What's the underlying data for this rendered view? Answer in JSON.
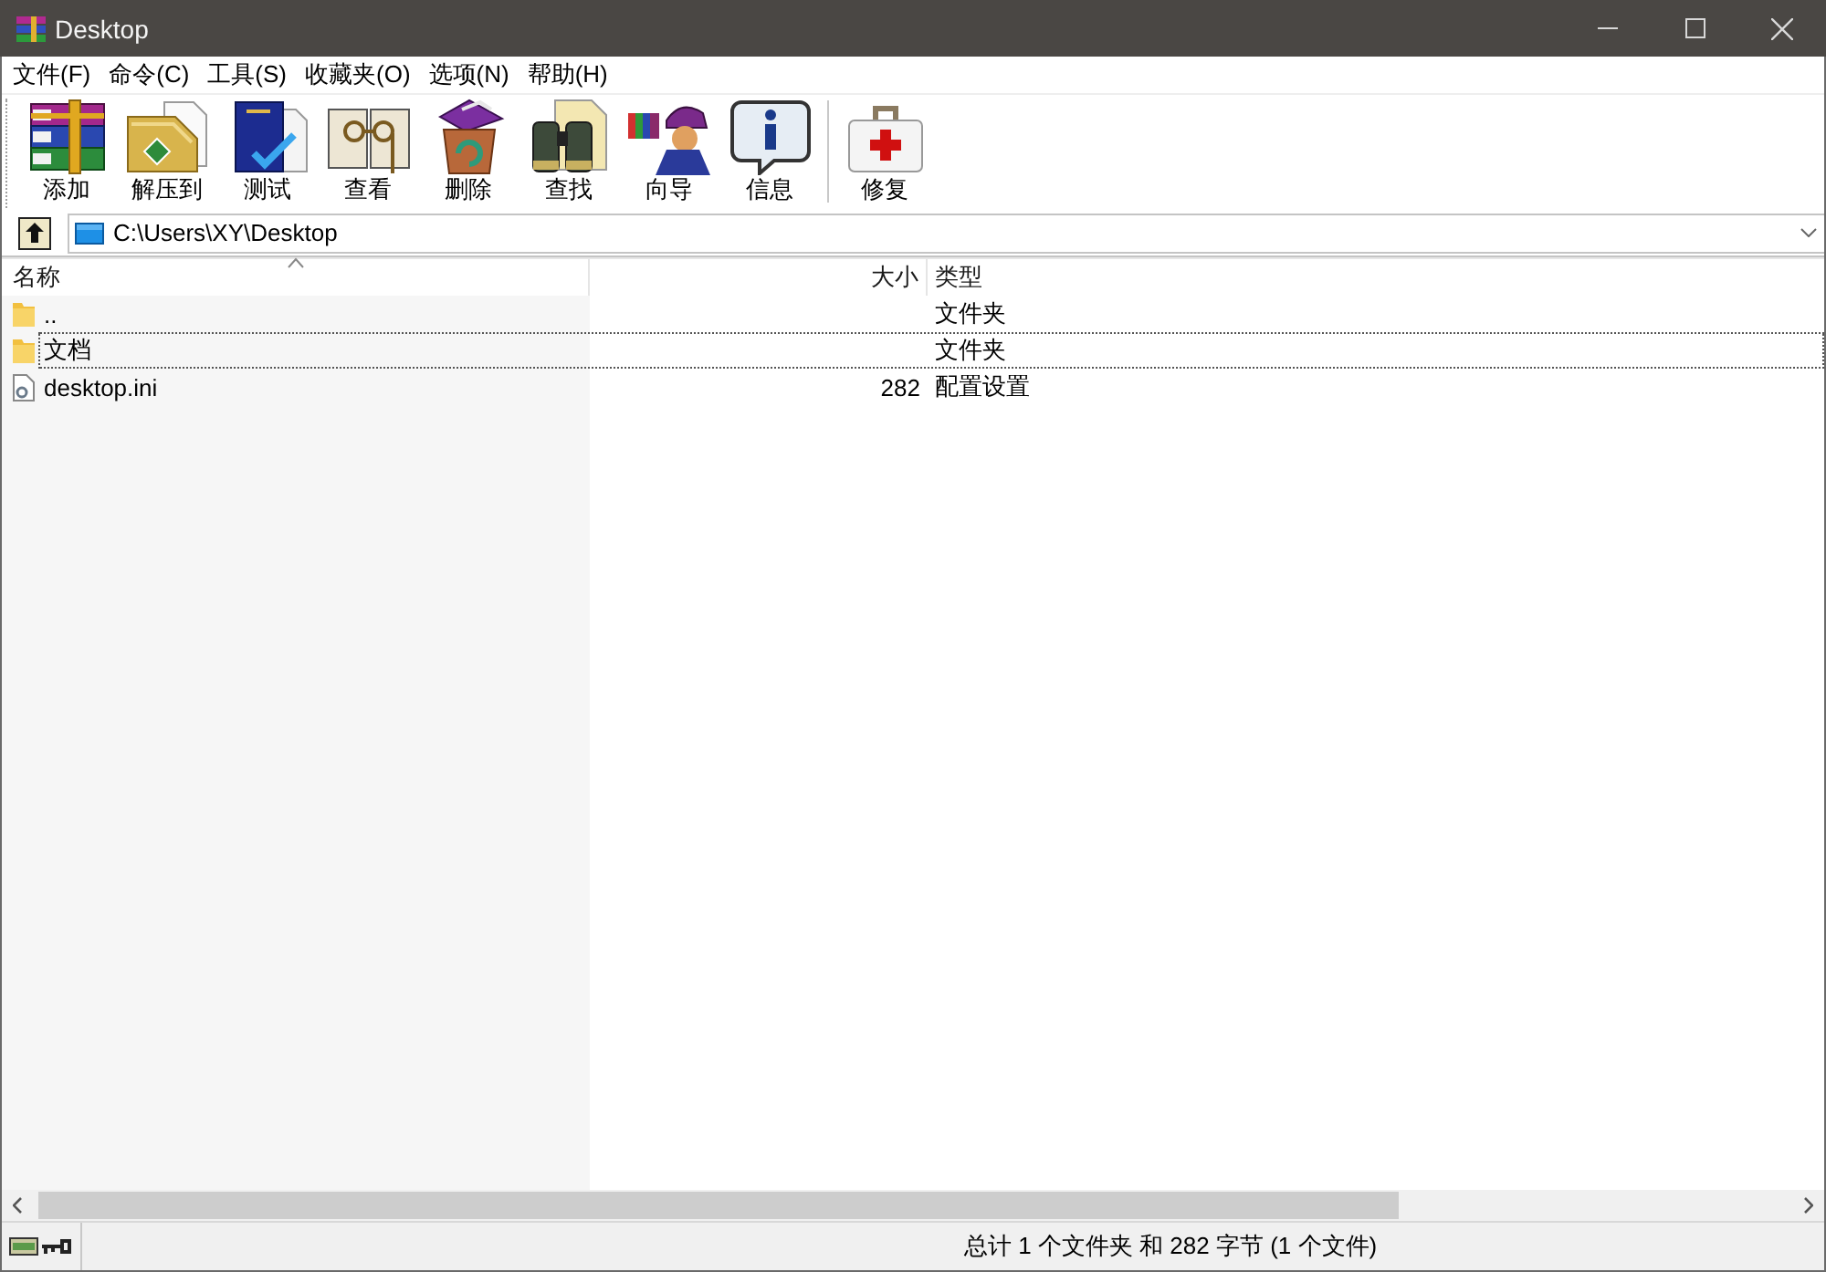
{
  "window": {
    "title": "Desktop"
  },
  "menu": [
    {
      "label": "文件(F)"
    },
    {
      "label": "命令(C)"
    },
    {
      "label": "工具(S)"
    },
    {
      "label": "收藏夹(O)"
    },
    {
      "label": "选项(N)"
    },
    {
      "label": "帮助(H)"
    }
  ],
  "toolbar": {
    "groups": [
      [
        {
          "label": "添加",
          "kind": "add"
        },
        {
          "label": "解压到",
          "kind": "extract"
        },
        {
          "label": "测试",
          "kind": "test"
        },
        {
          "label": "查看",
          "kind": "view"
        },
        {
          "label": "删除",
          "kind": "delete"
        },
        {
          "label": "查找",
          "kind": "find"
        },
        {
          "label": "向导",
          "kind": "wizard"
        },
        {
          "label": "信息",
          "kind": "info"
        }
      ],
      [
        {
          "label": "修复",
          "kind": "repair"
        }
      ]
    ]
  },
  "address_bar": {
    "path": "C:\\Users\\XY\\Desktop"
  },
  "file_list": {
    "columns": [
      {
        "label": "名称",
        "sorted": true
      },
      {
        "label": "大小",
        "sorted": false
      },
      {
        "label": "类型",
        "sorted": false
      }
    ],
    "rows": [
      {
        "name": "..",
        "type": "文件夹",
        "kind": "folder",
        "focused": false
      },
      {
        "name": "文档",
        "type": "文件夹",
        "kind": "folder",
        "focused": true
      },
      {
        "name": "desktop.ini",
        "size": "282",
        "type": "配置设置",
        "kind": "file",
        "focused": false
      }
    ]
  },
  "status_bar": {
    "text": "总计 1 个文件夹 和 282 字节 (1 个文件)"
  }
}
